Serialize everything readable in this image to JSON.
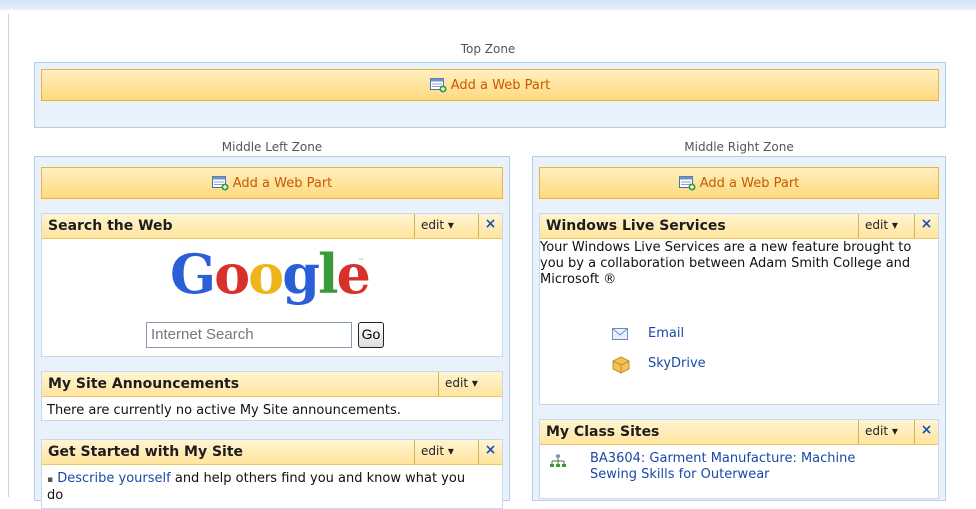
{
  "zones": {
    "top": {
      "label": "Top Zone",
      "add_label": "Add a Web Part"
    },
    "middle_left": {
      "label": "Middle Left Zone",
      "add_label": "Add a Web Part"
    },
    "middle_right": {
      "label": "Middle Right Zone",
      "add_label": "Add a Web Part"
    }
  },
  "search_web": {
    "title": "Search the Web",
    "edit_label": "edit ▾",
    "close_label": "×",
    "logo": [
      "G",
      "o",
      "o",
      "g",
      "l",
      "e"
    ],
    "logo_tm": "™",
    "search_placeholder": "Internet Search",
    "go_label": "Go"
  },
  "announcements": {
    "title": "My Site Announcements",
    "edit_label": "edit ▾",
    "text": "There are currently no active My Site announcements."
  },
  "get_started": {
    "title": "Get Started with My Site",
    "edit_label": "edit ▾",
    "close_label": "×",
    "bullet": "▪",
    "link_text": "Describe yourself",
    "rest_text": " and help others find you and know what you do"
  },
  "windows_live": {
    "title": "Windows Live Services",
    "edit_label": "edit ▾",
    "close_label": "×",
    "description": "Your Windows Live Services are a new feature brought to you by a collaboration between Adam Smith College and Microsoft ®",
    "services": [
      {
        "label": "Email",
        "icon": "envelope-icon"
      },
      {
        "label": "SkyDrive",
        "icon": "package-icon"
      }
    ]
  },
  "class_sites": {
    "title": "My Class Sites",
    "edit_label": "edit ▾",
    "close_label": "×",
    "items": [
      {
        "line1": "BA3604: Garment Manufacture: Machine",
        "line2": "Sewing Skills for Outerwear"
      }
    ]
  },
  "colors": {
    "add_bar_text": "#c45b00",
    "close_x": "#1a53b5",
    "link": "#1949a8"
  }
}
